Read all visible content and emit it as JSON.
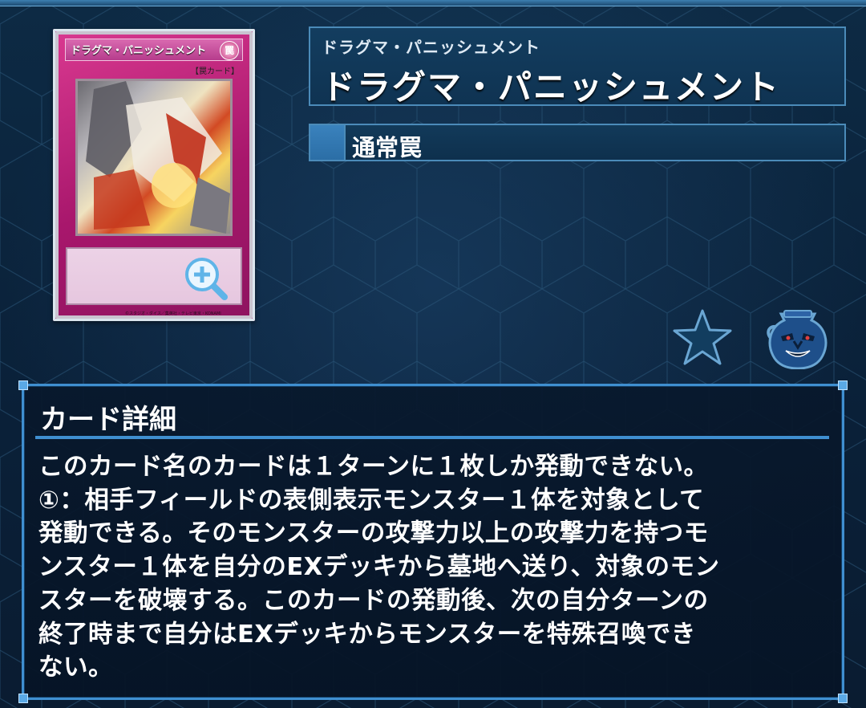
{
  "card": {
    "name": "ドラグマ・パニッシュメント",
    "ruby": "ドラグマ・パニッシュメント",
    "card_frame_name": "ドラグマ・パニッシュメント",
    "attribute_glyph": "罠",
    "type_tag": "【罠カード】",
    "copyright": "©スタジオ・ダイス／集英社・テレビ東京・KONAMI",
    "frame_color": "#b9207a"
  },
  "type": {
    "label": "通常罠",
    "swatch_color": "#2f75b0"
  },
  "icons": {
    "favorite": "star-icon",
    "pot": "pot-of-greed-icon",
    "zoom": "magnify-plus-icon"
  },
  "detail": {
    "heading": "カード詳細",
    "lines": [
      "このカード名のカードは１ターンに１枚しか発動できない。",
      "①：相手フィールドの表側表示モンスター１体を対象として",
      "発動できる。そのモンスターの攻撃力以上の攻撃力を持つモ",
      "ンスター１体を自分のEXデッキから墓地へ送り、対象のモン",
      "スターを破壊する。このカードの発動後、次の自分ターンの",
      "終了時まで自分はEXデッキからモンスターを特殊召喚でき",
      "ない。"
    ]
  },
  "colors": {
    "panel_border": "#3f8fd0",
    "background": "#0b2640",
    "accent": "#4b8bb9"
  }
}
